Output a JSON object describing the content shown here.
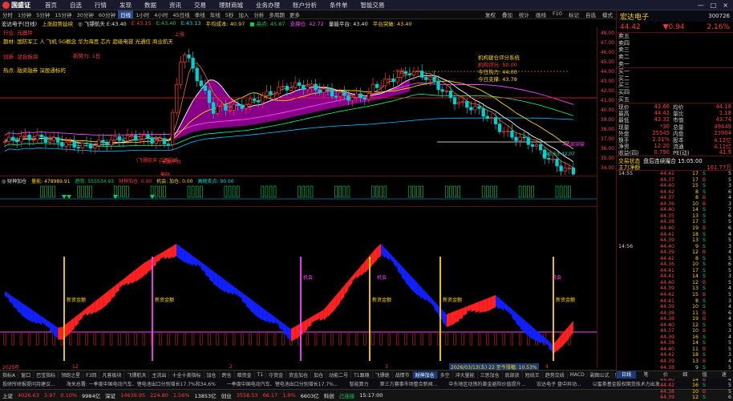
{
  "menu": {
    "logo": "国盛证",
    "items": [
      "首页",
      "自选",
      "行情",
      "发现",
      "数据",
      "资讯",
      "交易",
      "理财商城",
      "业务办理",
      "账户分析",
      "条件单",
      "智能交易"
    ],
    "controls": [
      "—",
      "□",
      "×"
    ]
  },
  "periods": {
    "items": [
      "分时",
      "1分钟",
      "5分钟",
      "15分钟",
      "30分钟",
      "60分钟",
      "日线",
      "1小时",
      "4小时",
      "45日线",
      "季线",
      "年线",
      "5秒",
      "加入",
      "分析",
      "多周期",
      "更多"
    ],
    "active": 6,
    "right": [
      "复权",
      "叠加",
      "统计",
      "画线",
      "F10",
      "标记",
      "自选",
      "模式"
    ]
  },
  "info": [
    {
      "t": "宏达电子(日线)",
      "c": "w"
    },
    {
      "t": "上涨趋势延续",
      "c": "y"
    },
    {
      "t": "◎ 飞镖航天 E:43.40",
      "c": "w"
    },
    {
      "t": "E:43.15",
      "c": "r"
    },
    {
      "t": "E:43.40",
      "c": "g"
    },
    {
      "t": "E:43.13",
      "c": "c"
    },
    {
      "t": "平均成本: 40.97",
      "c": "y"
    },
    {
      "t": "■ 高点: 45.87",
      "c": "g"
    },
    {
      "t": "支撑位: 42.72",
      "c": "m"
    },
    {
      "t": "量能平台: 43.40",
      "c": "w"
    },
    {
      "t": "平台突破: 43.40",
      "c": "y"
    }
  ],
  "overlay": {
    "row1": "行业: 元器件",
    "row2": "题材: 国防军工 人 飞机 5G概念 华为海思 芯片 超级电容 光通信 商业航天",
    "row3": "创新: 混合板块",
    "row4": "新势力: 1日",
    "row5": "热点: 融资融券 深股通标的",
    "label_up": "上涨",
    "label_sup": "支撑位",
    "label_dn": "下跌",
    "label_cross": "均线共振",
    "label_chip": "筹码",
    "label_line": "\\飞镖航天 三路防线",
    "label_flat": "\\ 长期平台",
    "label_bottom": "▲43.63   42.07",
    "label_rt": "→底部突破",
    "label_vol": "成交量 资金",
    "label_kday": "100天"
  },
  "eval": {
    "title": "机构建仓评分系统",
    "l1": "机构评分: 50.00",
    "l2": "今日热力: 44.00",
    "l3": "今日支撑: 43.78"
  },
  "prices": [
    "48.00",
    "47.00",
    "46.00",
    "45.00",
    "44.00",
    "43.00",
    "42.00",
    "41.00",
    "40.00",
    "39.00",
    "38.00",
    "37.00",
    "36.00",
    "35.00",
    "34.00"
  ],
  "sub1": {
    "title": "◎ 财神加仓",
    "t2": "量能: 478989.91",
    "t3": "趋势: 555534.93",
    "t4": "财神加仓: 0.00",
    "t5": "机会: 加仓: 0.00",
    "t6": "高抛支点: 90.00"
  },
  "sub2": {
    "labels": [
      "新资金额",
      "新资金额",
      "新资金额",
      "新资金额",
      "新资金额"
    ],
    "mk": "机会",
    "tag": "2026/03/13(五) 22 至今涨幅: 10.53%"
  },
  "dates": [
    "2025年",
    "12",
    "2",
    "3",
    "4"
  ],
  "date_marker": "2026/03/13(五) 22 至今涨幅: 10.53%",
  "tabs": {
    "items": [
      "指标A",
      "窗口",
      "巴宝指标",
      "领跑之星",
      "F3回",
      "凡客板块",
      "飞镖航天",
      "主流出",
      "十全十美指标",
      "加仓",
      "跨仓",
      "暗资金",
      "T1",
      "守资金",
      "资金加仓",
      "加仓",
      "动能二号",
      "T1跟随",
      "飞镖绝",
      "战情节",
      "财神加仓",
      "多空",
      "冲大量能",
      "三思加仓",
      "底部放",
      "短线王",
      "趋势交线",
      "MACD",
      "副图公式",
      "新资增流",
      "多空顶",
      "短线强哥",
      "更多"
    ],
    "active": 20
  },
  "news": [
    "投研所研报提问持建议...",
    "海关总署: 一季度中国电动汽车、锂电池出口分别增长17.7%和34.6%",
    "一季度中国电动汽车、锂电池出口分别增长17.7%...",
    "智能算力",
    "第三方赛事市场整合新闻...",
    "中东地区动荡的黄金避险价值提升...",
    "宏达电子 盘中异动...",
    "以蜜茶基金股权期货技术力出发..."
  ],
  "status": [
    {
      "t": "上证",
      "c": "w"
    },
    {
      "t": "4026.63",
      "c": "r"
    },
    {
      "t": "3.97",
      "c": "r"
    },
    {
      "t": "0.10%",
      "c": "r"
    },
    {
      "t": "9984亿",
      "c": "w"
    },
    {
      "t": "深证",
      "c": "w"
    },
    {
      "t": "14639.95",
      "c": "r"
    },
    {
      "t": "224.80",
      "c": "r"
    },
    {
      "t": "1.56%",
      "c": "r"
    },
    {
      "t": "13853亿",
      "c": "w"
    },
    {
      "t": "创业",
      "c": "w"
    },
    {
      "t": "3558.53",
      "c": "r"
    },
    {
      "t": "66.17",
      "c": "r"
    },
    {
      "t": "1.9%",
      "c": "r"
    },
    {
      "t": "6603亿",
      "c": "w"
    },
    {
      "t": "科创",
      "c": "w"
    },
    {
      "t": "己连接",
      "c": "g"
    },
    {
      "t": "15:17:00",
      "c": "w"
    }
  ],
  "rp": {
    "name": "宏达电子",
    "code": "300726",
    "price": "44.42",
    "change": "▼0.94",
    "pct": "2.16%",
    "asks": [
      {
        "l": "卖五",
        "p": "",
        "v": ""
      },
      {
        "l": "卖四",
        "p": "",
        "v": ""
      },
      {
        "l": "卖三",
        "p": "",
        "v": ""
      },
      {
        "l": "卖二",
        "p": "",
        "v": ""
      },
      {
        "l": "卖一",
        "p": "",
        "v": ""
      }
    ],
    "bids": [
      {
        "l": "买一",
        "p": "",
        "v": ""
      },
      {
        "l": "买二",
        "p": "",
        "v": ""
      },
      {
        "l": "买三",
        "p": "",
        "v": ""
      },
      {
        "l": "买四",
        "p": "",
        "v": ""
      },
      {
        "l": "买五",
        "p": "",
        "v": ""
      }
    ],
    "stats": [
      [
        "现价",
        "43.66",
        "均价",
        "44.18"
      ],
      [
        "最高",
        "44.42",
        "量比",
        "1.18"
      ],
      [
        "最低",
        "43.32",
        "市值",
        "43.74"
      ],
      [
        "现量",
        "*30",
        "总量",
        "49449"
      ],
      [
        "外盘",
        "25545",
        "内盘",
        "23904"
      ],
      [
        "换手",
        "2.31%",
        "股本",
        "4.12亿"
      ],
      [
        "净资",
        "12.20",
        "流通",
        "4.12亿"
      ],
      [
        "收益(四)",
        "0.790",
        "PE(动)",
        "41.9"
      ]
    ],
    "status_l": "交易状态",
    "status_v": "盘后连续撮合 15:05:00",
    "net_l": "主力净额",
    "net_v": "161.77万",
    "trades": [
      [
        "14:55",
        "44.42",
        "17",
        "S",
        "5"
      ],
      [
        "",
        "44.37",
        "17",
        "B",
        "5"
      ],
      [
        "",
        "44.40",
        "15",
        "S",
        "3"
      ],
      [
        "",
        "44.42",
        "8",
        "S",
        "6"
      ],
      [
        "",
        "44.37",
        "8",
        "B",
        "4"
      ],
      [
        "",
        "44.36",
        "10",
        "B",
        "3"
      ],
      [
        "",
        "44.40",
        "14",
        "S",
        "7"
      ],
      [
        "",
        "44.35",
        "13",
        "S",
        "6"
      ],
      [
        "",
        "44.38",
        "17",
        "S",
        "5"
      ],
      [
        "",
        "44.40",
        "19",
        "B",
        "6"
      ],
      [
        "",
        "44.41",
        "18",
        "S",
        "4"
      ],
      [
        "",
        "44.39",
        "13",
        "S",
        "5"
      ],
      [
        "14:56",
        "44.40",
        "9",
        "S",
        "3"
      ],
      [
        "",
        "44.39",
        "12",
        "B",
        "4"
      ],
      [
        "",
        "44.42",
        "8",
        "S",
        "5"
      ],
      [
        "",
        "44.36",
        "10",
        "S",
        "6"
      ],
      [
        "",
        "44.41",
        "17",
        "S",
        "5"
      ],
      [
        "",
        "44.41",
        "14",
        "S",
        "3"
      ],
      [
        "",
        "44.40",
        "12",
        "B",
        "5"
      ],
      [
        "",
        "44.39",
        "13",
        "S",
        "4"
      ],
      [
        "",
        "44.42",
        "15",
        "B",
        "5"
      ],
      [
        "",
        "44.41",
        "8",
        "S",
        "3"
      ],
      [
        "",
        "44.39",
        "10",
        "S",
        "4"
      ],
      [
        "",
        "44.38",
        "11",
        "B",
        "6"
      ],
      [
        "",
        "44.38",
        "19",
        "B",
        "4"
      ],
      [
        "",
        "44.40",
        "12",
        "S",
        "5"
      ],
      [
        "",
        "44.37",
        "10",
        "B",
        "3"
      ],
      [
        "",
        "44.39",
        "16",
        "S",
        "4"
      ],
      [
        "",
        "44.38",
        "14",
        "S",
        "5"
      ],
      [
        "",
        "44.40",
        "11",
        "B",
        "5"
      ],
      [
        "",
        "44.42",
        "18",
        "S",
        "3"
      ],
      [
        "",
        "44.39",
        "13",
        "B",
        "4"
      ],
      [
        "",
        "44.38",
        "9",
        "S",
        "5"
      ],
      [
        "",
        "44.41",
        "12",
        "S",
        "6"
      ],
      [
        "",
        "44.40",
        "14",
        "B",
        "4"
      ],
      [
        "",
        "44.42",
        "16",
        "S",
        "5"
      ],
      [
        "",
        "44.38",
        "10",
        "B",
        "5"
      ],
      [
        "",
        "44.39",
        "12",
        "S",
        "6"
      ],
      [
        "",
        "44.40",
        "13",
        "S",
        "4"
      ]
    ],
    "tabs": [
      "日线",
      "笔",
      "价",
      "细",
      "值",
      "速"
    ],
    "tab_active": 0
  },
  "colors": {
    "up": "#ff3838",
    "down": "#00d0d0",
    "ma1": "#ffffff",
    "ma2": "#ffd700",
    "ma3": "#ff40ff",
    "ma4": "#00ff80",
    "ma5": "#00c0ff",
    "fill": "#a000a0",
    "red_area": "#ff2020",
    "blue_area": "#1020ff"
  }
}
